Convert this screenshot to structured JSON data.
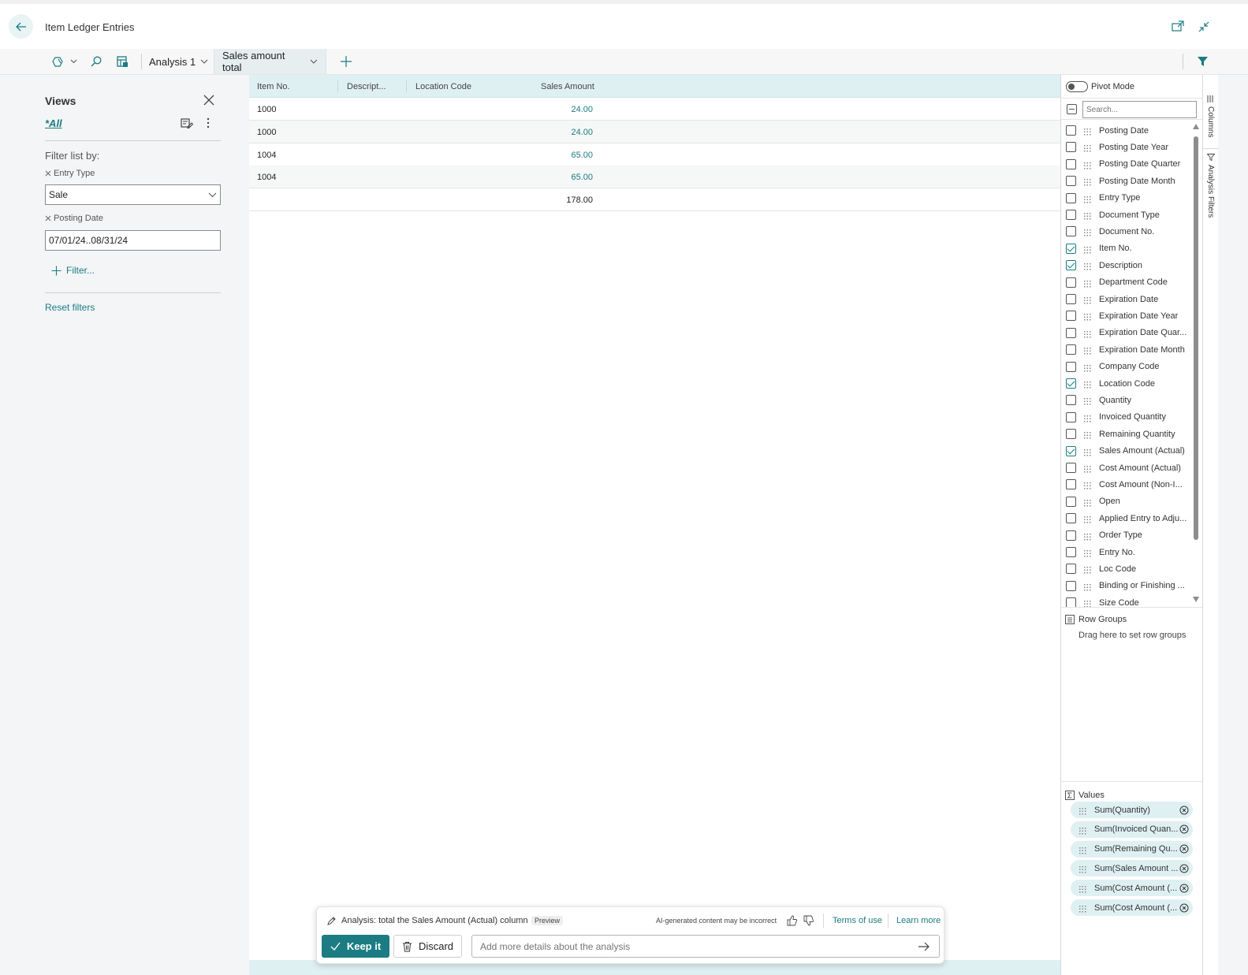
{
  "window": {
    "title": "Item Ledger Entries"
  },
  "toolbar": {
    "tabs": [
      {
        "label": "Analysis 1"
      },
      {
        "label": "Sales amount total"
      }
    ]
  },
  "views": {
    "title": "Views",
    "current_view": "*All",
    "filter_list_by": "Filter list by:",
    "filters": [
      {
        "label": "Entry Type",
        "value": "Sale"
      },
      {
        "label": "Posting Date",
        "value": "07/01/24..08/31/24"
      }
    ],
    "add_filter": "Filter...",
    "reset_filters": "Reset filters"
  },
  "grid": {
    "columns": [
      "Item No.",
      "Descript...",
      "Location Code",
      "Sales Amount"
    ],
    "rows": [
      {
        "item_no": "1000",
        "description": "",
        "location_code": "",
        "sales_amount": "24.00"
      },
      {
        "item_no": "1000",
        "description": "",
        "location_code": "",
        "sales_amount": "24.00"
      },
      {
        "item_no": "1004",
        "description": "",
        "location_code": "",
        "sales_amount": "65.00"
      },
      {
        "item_no": "1004",
        "description": "",
        "location_code": "",
        "sales_amount": "65.00"
      }
    ],
    "total": "178.00"
  },
  "column_panel": {
    "pivot_mode": "Pivot Mode",
    "search_placeholder": "Search...",
    "columns": [
      {
        "label": "Posting Date",
        "checked": false
      },
      {
        "label": "Posting Date Year",
        "checked": false
      },
      {
        "label": "Posting Date Quarter",
        "checked": false
      },
      {
        "label": "Posting Date Month",
        "checked": false
      },
      {
        "label": "Entry Type",
        "checked": false
      },
      {
        "label": "Document Type",
        "checked": false
      },
      {
        "label": "Document No.",
        "checked": false
      },
      {
        "label": "Item No.",
        "checked": true
      },
      {
        "label": "Description",
        "checked": true
      },
      {
        "label": "Department Code",
        "checked": false
      },
      {
        "label": "Expiration Date",
        "checked": false
      },
      {
        "label": "Expiration Date Year",
        "checked": false
      },
      {
        "label": "Expiration Date Quar...",
        "checked": false
      },
      {
        "label": "Expiration Date Month",
        "checked": false
      },
      {
        "label": "Company Code",
        "checked": false
      },
      {
        "label": "Location Code",
        "checked": true
      },
      {
        "label": "Quantity",
        "checked": false
      },
      {
        "label": "Invoiced Quantity",
        "checked": false
      },
      {
        "label": "Remaining Quantity",
        "checked": false
      },
      {
        "label": "Sales Amount (Actual)",
        "checked": true
      },
      {
        "label": "Cost Amount (Actual)",
        "checked": false
      },
      {
        "label": "Cost Amount (Non-I...",
        "checked": false
      },
      {
        "label": "Open",
        "checked": false
      },
      {
        "label": "Applied Entry to Adju...",
        "checked": false
      },
      {
        "label": "Order Type",
        "checked": false
      },
      {
        "label": "Entry No.",
        "checked": false
      },
      {
        "label": "Loc Code",
        "checked": false
      },
      {
        "label": "Binding or Finishing ...",
        "checked": false
      },
      {
        "label": "Size Code",
        "checked": false
      }
    ],
    "row_groups_title": "Row Groups",
    "row_groups_hint": "Drag here to set row groups",
    "values_title": "Values",
    "values": [
      "Sum(Quantity)",
      "Sum(Invoiced Quan...",
      "Sum(Remaining Qu...",
      "Sum(Sales Amount ...",
      "Sum(Cost Amount (...",
      "Sum(Cost Amount (..."
    ]
  },
  "side_tabs": {
    "columns": "Columns",
    "analysis_filters": "Analysis Filters"
  },
  "copilot": {
    "title": "Analysis: total the Sales Amount (Actual) column",
    "preview_badge": "Preview",
    "disclaimer": "AI-generated content may be incorrect",
    "terms": "Terms of use",
    "learn_more": "Learn more",
    "keep_label": "Keep it",
    "discard_label": "Discard",
    "input_placeholder": "Add more details about the analysis"
  },
  "colors": {
    "accent": "#1b7c83",
    "grid_header": "#dff0f2"
  }
}
